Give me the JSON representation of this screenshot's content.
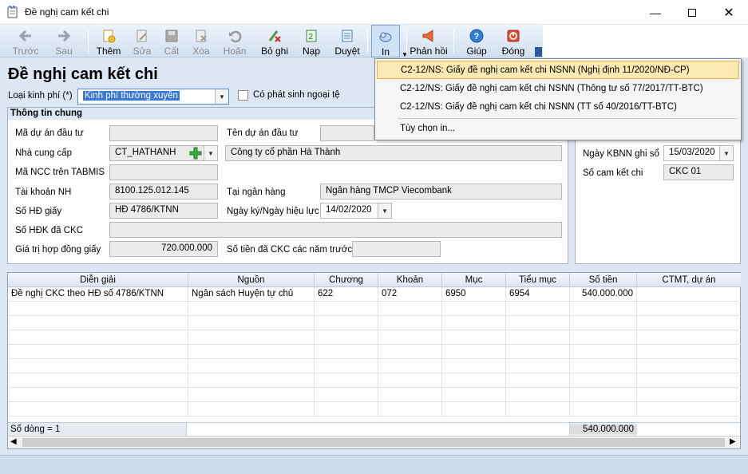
{
  "window": {
    "title": "Đề nghị cam kết chi",
    "controls": [
      "minimize-icon",
      "maximize-icon",
      "close-icon"
    ]
  },
  "toolbar": {
    "buttons": [
      {
        "label": "Trước",
        "icon": "arrow-left-icon",
        "enabled": false
      },
      {
        "label": "Sau",
        "icon": "arrow-right-icon",
        "enabled": false
      },
      {
        "label": "Thêm",
        "icon": "add-document-icon",
        "enabled": true
      },
      {
        "label": "Sửa",
        "icon": "edit-document-icon",
        "enabled": false
      },
      {
        "label": "Cất",
        "icon": "save-icon",
        "enabled": false
      },
      {
        "label": "Xóa",
        "icon": "delete-document-icon",
        "enabled": false
      },
      {
        "label": "Hoãn",
        "icon": "undo-icon",
        "enabled": false
      },
      {
        "label": "Bỏ ghi",
        "icon": "unpost-icon",
        "enabled": true
      },
      {
        "label": "Nạp",
        "icon": "load-icon",
        "enabled": true
      },
      {
        "label": "Duyệt",
        "icon": "approve-icon",
        "enabled": true
      },
      {
        "label": "In",
        "icon": "print-icon",
        "enabled": true
      },
      {
        "label": "Phản hồi",
        "icon": "feedback-icon",
        "enabled": true
      },
      {
        "label": "Giúp",
        "icon": "help-icon",
        "enabled": true
      },
      {
        "label": "Đóng",
        "icon": "close-form-icon",
        "enabled": true
      }
    ]
  },
  "print_menu": {
    "items": [
      "C2-12/NS: Giấy đề nghị cam kết chi NSNN  (Nghị định 11/2020/NĐ-CP)",
      "C2-12/NS: Giấy đề nghị cam kết chi NSNN (Thông tư số 77/2017/TT-BTC)",
      "C2-12/NS: Giấy đề nghị cam kết chi NSNN (TT số 40/2016/TT-BTC)",
      "Tùy chọn in..."
    ],
    "selected_index": 0
  },
  "form": {
    "title": "Đề nghị cam kết chi",
    "loai_kinh_phi_label": "Loại kinh phí (*)",
    "loai_kinh_phi_value": "Kinh phí thường xuyên",
    "ngoai_te_label": "Có phát sinh ngoại tệ",
    "group_title": "Thông tin chung",
    "ma_du_an_label": "Mã dự án đầu tư",
    "ma_du_an_value": "",
    "ten_du_an_label": "Tên dự án đầu tư",
    "ten_du_an_value": "",
    "nha_cung_cap_label": "Nhà cung cấp",
    "nha_cung_cap_code": "CT_HATHANH",
    "nha_cung_cap_name": "Công ty cổ phần Hà Thành",
    "ma_ncc_label": "Mã NCC trên TABMIS",
    "ma_ncc_value": "",
    "tai_khoan_label": "Tài khoản NH",
    "tai_khoan_value": "8100.125.012.145",
    "ngan_hang_label": "Tại ngân hàng",
    "ngan_hang_value": "Ngân hàng TMCP Viecombank",
    "so_hd_label": "Số HĐ giấy",
    "so_hd_value": "HĐ 4786/KTNN",
    "ngay_ky_label": "Ngày ký/Ngày hiệu lực",
    "ngay_ky_value": "14/02/2020",
    "so_hdk_label": "Số HĐK đã CKC",
    "so_hdk_value": "",
    "gia_tri_label": "Giá trị hợp đồng giấy",
    "gia_tri_value": "720.000.000",
    "so_tien_truoc_label": "Số tiền đã CKC các năm trước",
    "so_tien_truoc_value": "",
    "ngay_kbnn_label": "Ngày KBNN ghi sổ",
    "ngay_kbnn_value": "15/03/2020",
    "so_ck_label": "Số cam kết chi",
    "so_ck_value": "CKC 01"
  },
  "grid": {
    "columns": [
      "Diễn giải",
      "Nguồn",
      "Chương",
      "Khoản",
      "Mục",
      "Tiểu mục",
      "Số tiền",
      "CTMT, dự án"
    ],
    "rows": [
      [
        "Đề nghị CKC theo HĐ số 4786/KTNN",
        "Ngân sách Huyện tự chủ",
        "622",
        "072",
        "6950",
        "6954",
        "540.000.000",
        ""
      ]
    ],
    "footer_count": "Số dòng = 1",
    "footer_total": "540.000.000"
  }
}
